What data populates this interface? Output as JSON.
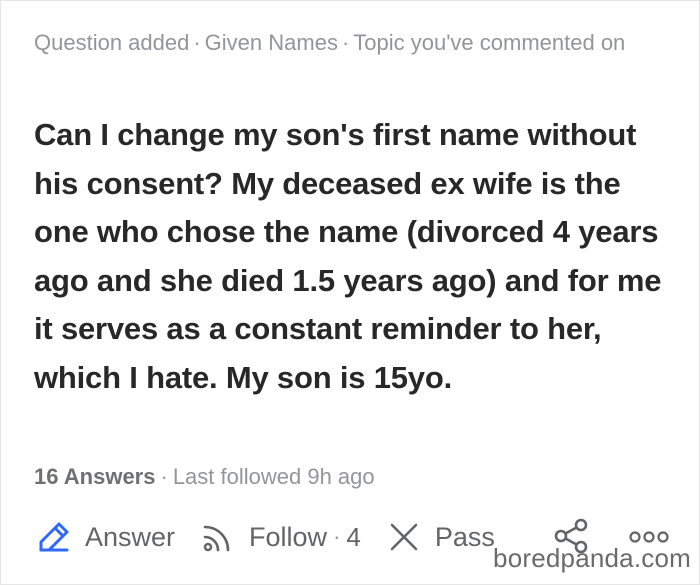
{
  "meta": {
    "event": "Question added",
    "topic": "Given Names",
    "context": "Topic you've commented on",
    "separator": "·"
  },
  "question": {
    "text": "Can I change my son's first name without his consent? My deceased ex wife is the one who chose the name (divorced 4 years ago and she died 1.5 years ago) and for me it serves as a constant reminder to her, which I hate. My son is 15yo."
  },
  "stats": {
    "answers": "16 Answers",
    "separator": "·",
    "last_followed": "Last followed 9h ago"
  },
  "actions": {
    "answer_label": "Answer",
    "follow_label": "Follow",
    "follow_separator": "·",
    "follow_count": "4",
    "pass_label": "Pass",
    "icons": {
      "answer": "pencil-edit-icon",
      "follow": "follow-rss-icon",
      "pass": "pass-x-icon",
      "share": "share-icon",
      "more": "more-dots-icon"
    }
  },
  "watermark": "boredpanda.com",
  "colors": {
    "accent_blue": "#2e69ff",
    "text_primary": "#282829",
    "text_secondary": "#939598",
    "icon_gray": "#636466"
  }
}
